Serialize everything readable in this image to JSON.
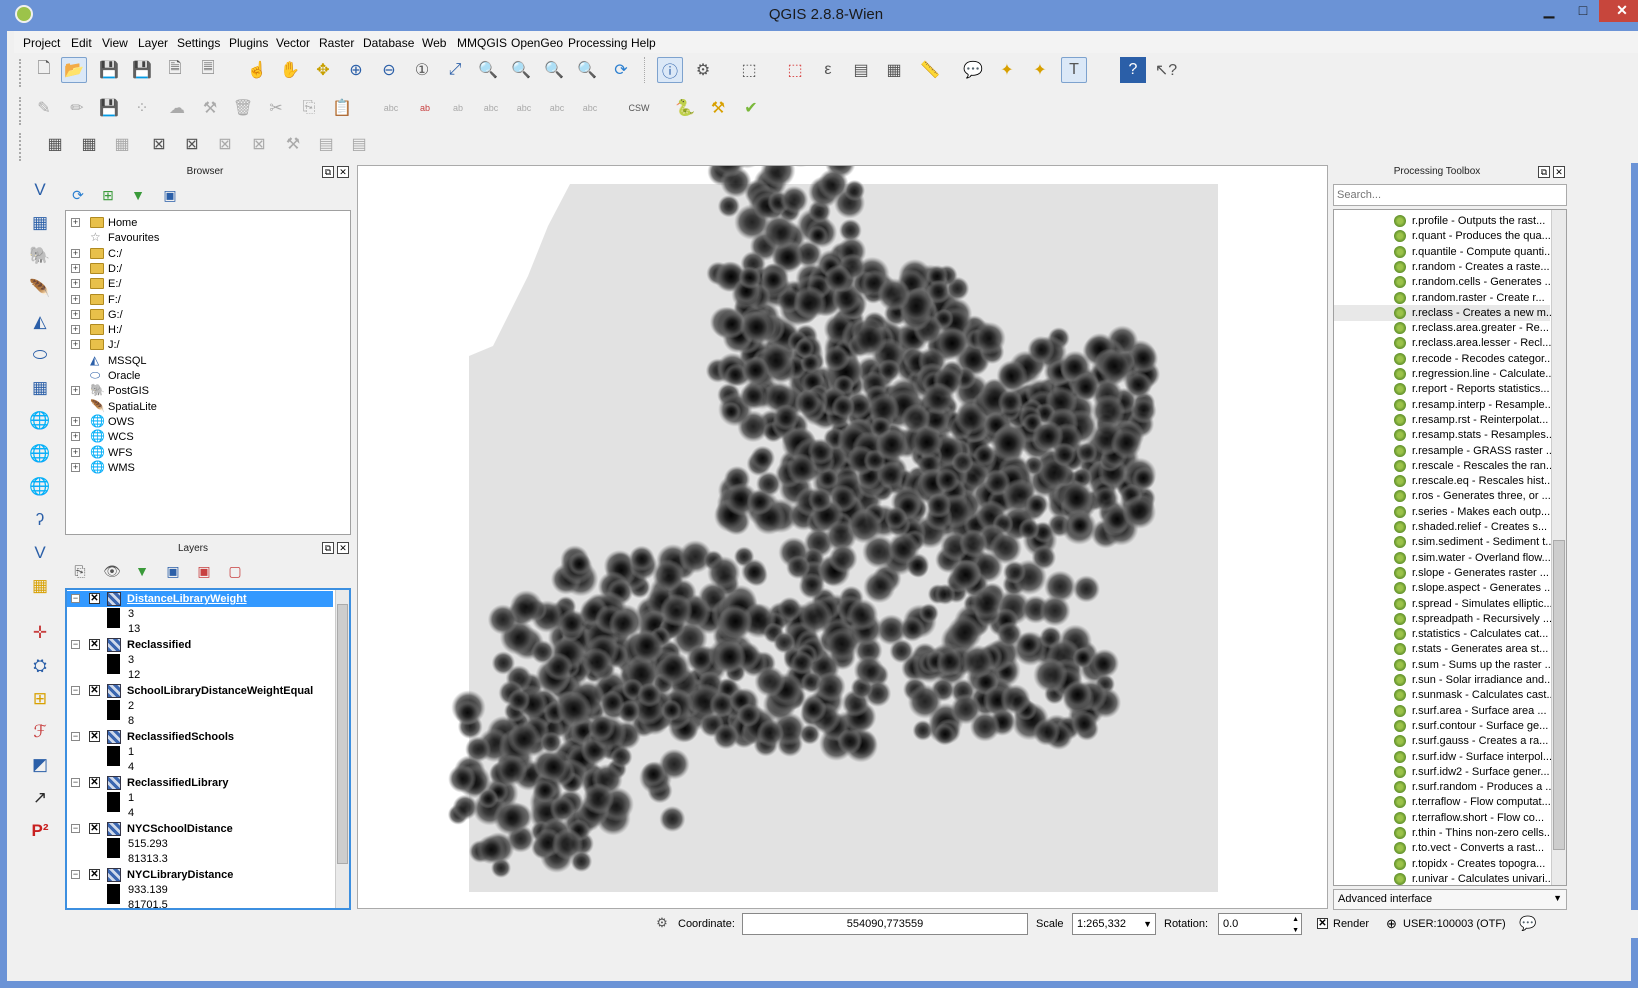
{
  "window": {
    "title": "QGIS 2.8.8-Wien",
    "min": "▁",
    "max": "□",
    "close": "✕"
  },
  "menu": [
    "Project",
    "Edit",
    "View",
    "Layer",
    "Settings",
    "Plugins",
    "Vector",
    "Raster",
    "Database",
    "Web",
    "MMQGIS",
    "OpenGeo",
    "Processing",
    "Help"
  ],
  "browser": {
    "title": "Browser",
    "items": [
      "Home",
      "Favourites",
      "C:/",
      "D:/",
      "E:/",
      "F:/",
      "G:/",
      "H:/",
      "J:/",
      "MSSQL",
      "Oracle",
      "PostGIS",
      "SpatiaLite",
      "OWS",
      "WCS",
      "WFS",
      "WMS"
    ]
  },
  "layers": {
    "title": "Layers",
    "items": [
      {
        "name": "DistanceLibraryWeight",
        "min": "3",
        "max": "13",
        "selected": true
      },
      {
        "name": "Reclassified",
        "min": "3",
        "max": "12"
      },
      {
        "name": "SchoolLibraryDistanceWeightEqual",
        "min": "2",
        "max": "8"
      },
      {
        "name": "ReclassifiedSchools",
        "min": "1",
        "max": "4"
      },
      {
        "name": "ReclassifiedLibrary",
        "min": "1",
        "max": "4"
      },
      {
        "name": "NYCSchoolDistance",
        "min": "515.293",
        "max": "81313.3"
      },
      {
        "name": "NYCLibraryDistance",
        "min": "933.139",
        "max": "81701.5"
      }
    ]
  },
  "processing": {
    "title": "Processing Toolbox",
    "search_placeholder": "Search...",
    "items": [
      "r.profile - Outputs the rast...",
      "r.quant - Produces the qua...",
      "r.quantile - Compute quanti...",
      "r.random - Creates a raste...",
      "r.random.cells - Generates ...",
      "r.random.raster - Create r...",
      "r.reclass - Creates a new m...",
      "r.reclass.area.greater - Re...",
      "r.reclass.area.lesser - Recl...",
      "r.recode - Recodes categor...",
      "r.regression.line - Calculate...",
      "r.report - Reports statistics...",
      "r.resamp.interp - Resample...",
      "r.resamp.rst - Reinterpolat...",
      "r.resamp.stats - Resamples...",
      "r.resample - GRASS raster ...",
      "r.rescale - Rescales the ran...",
      "r.rescale.eq - Rescales hist...",
      "r.ros - Generates three, or ...",
      "r.series - Makes each outp...",
      "r.shaded.relief - Creates s...",
      "r.sim.sediment - Sediment t...",
      "r.sim.water - Overland flow...",
      "r.slope - Generates raster ...",
      "r.slope.aspect - Generates ...",
      "r.spread - Simulates elliptic...",
      "r.spreadpath - Recursively ...",
      "r.statistics - Calculates cat...",
      "r.stats - Generates area st...",
      "r.sum - Sums up the raster ...",
      "r.sun - Solar irradiance and...",
      "r.sunmask - Calculates cast...",
      "r.surf.area - Surface area ...",
      "r.surf.contour - Surface ge...",
      "r.surf.gauss - Creates a ra...",
      "r.surf.idw - Surface interpol...",
      "r.surf.idw2 - Surface gener...",
      "r.surf.random - Produces a ...",
      "r.terraflow - Flow computat...",
      "r.terraflow.short - Flow co...",
      "r.thin - Thins non-zero cells...",
      "r.to.vect - Converts a rast...",
      "r.topidx - Creates topogra...",
      "r.univar - Calculates univari..."
    ],
    "mode": "Advanced interface"
  },
  "status": {
    "coordinate_label": "Coordinate:",
    "coordinate": "554090,773559",
    "scale_label": "Scale",
    "scale": "1:265,332",
    "rotation_label": "Rotation:",
    "rotation": "0.0",
    "render_label": "Render",
    "crs": "USER:100003 (OTF)"
  }
}
